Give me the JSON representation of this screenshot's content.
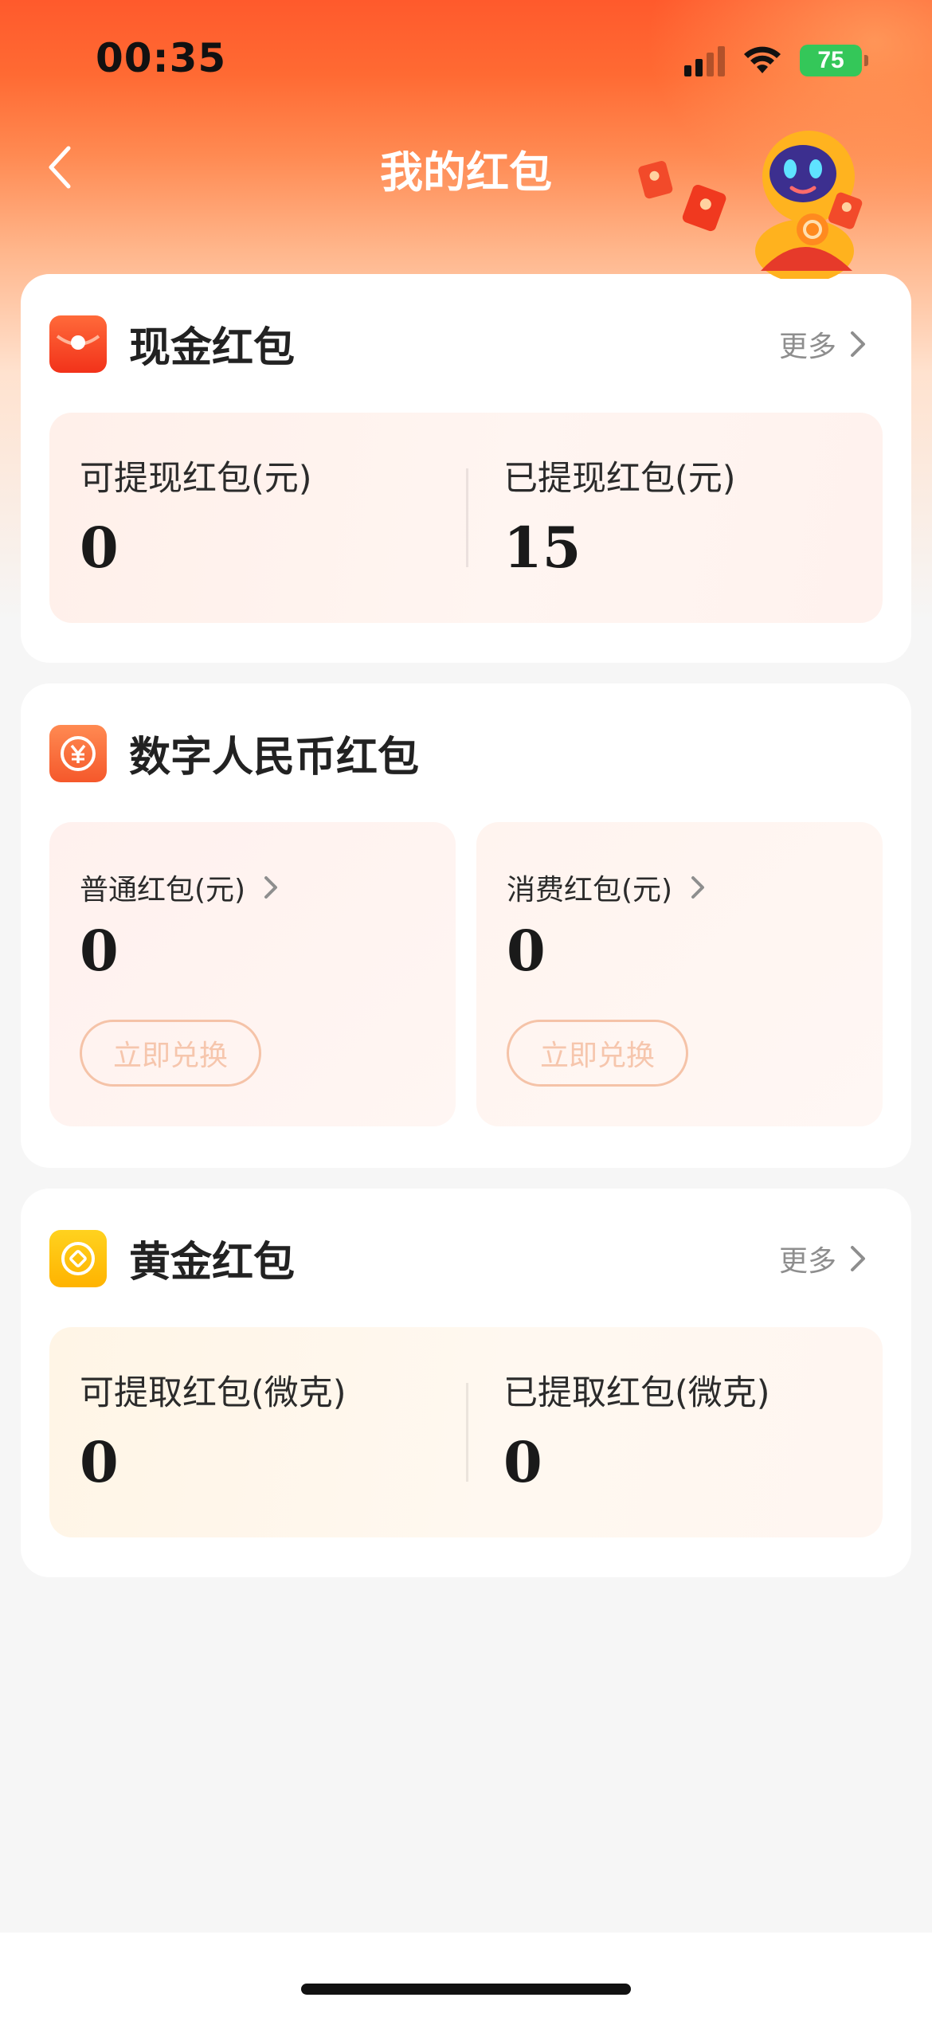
{
  "status_bar": {
    "time": "00:35",
    "battery": "75"
  },
  "header": {
    "title": "我的红包"
  },
  "cash_section": {
    "title": "现金红包",
    "more_label": "更多",
    "withdrawable_label": "可提现红包(元)",
    "withdrawable_value": "0",
    "withdrawn_label": "已提现红包(元)",
    "withdrawn_value": "15"
  },
  "digital_rmb_section": {
    "title": "数字人民币红包",
    "normal": {
      "label": "普通红包(元)",
      "value": "0",
      "button_label": "立即兑换"
    },
    "consumption": {
      "label": "消费红包(元)",
      "value": "0",
      "button_label": "立即兑换"
    }
  },
  "gold_section": {
    "title": "黄金红包",
    "more_label": "更多",
    "withdrawable_label": "可提取红包(微克)",
    "withdrawable_value": "0",
    "withdrawn_label": "已提取红包(微克)",
    "withdrawn_value": "0"
  },
  "icons": {
    "back": "chevron-left-icon",
    "cash": "red-envelope-icon",
    "digital_rmb": "digital-rmb-icon",
    "gold": "gold-coin-icon",
    "more": "chevron-right-icon"
  },
  "colors": {
    "header_gradient_top": "#ff5a2c",
    "cash_icon": "#ff4a1f",
    "digital_icon": "#ff6a3a",
    "gold_icon": "#ffc400",
    "exchange_button_border": "#f5c3a8",
    "battery": "#34c759"
  }
}
